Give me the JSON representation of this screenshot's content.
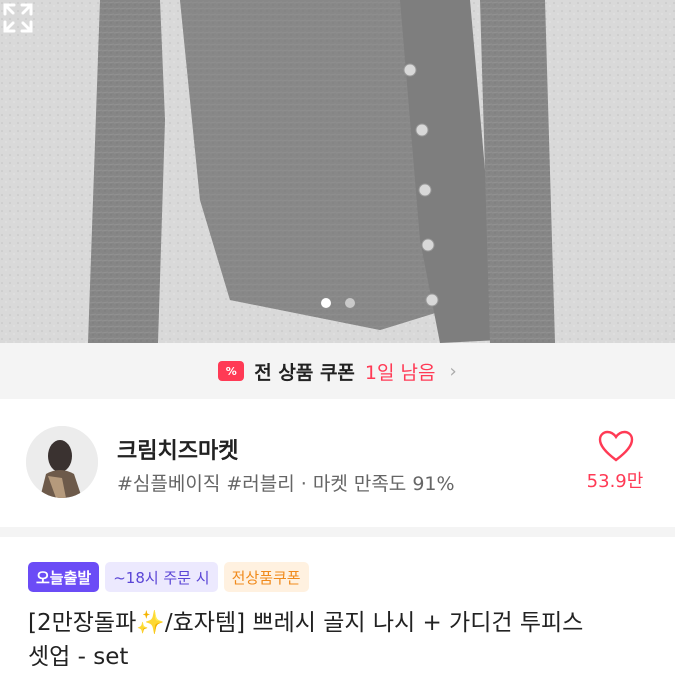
{
  "product_image": {
    "alt": "gray knit cardigan set",
    "carousel_total": 2,
    "carousel_active": 1,
    "expand_icon": "expand-icon"
  },
  "coupon": {
    "icon_label": "%",
    "text": "전 상품 쿠폰",
    "remaining": "1일 남음",
    "chevron": "›"
  },
  "shop": {
    "name": "크림치즈마켓",
    "tags": "#심플베이직 #러블리 · 마켓 만족도 91%",
    "likes": "53.9만",
    "heart_icon": "heart-icon"
  },
  "badges": [
    {
      "label": "오늘출발"
    },
    {
      "label": "~18시 주문 시"
    },
    {
      "label": "전상품쿠폰"
    }
  ],
  "product": {
    "title_prefix": "[2만장돌파",
    "sparkle": "✨",
    "title_rest": "/효자템] 쁘레시 골지 나시 + 가디건 투피스",
    "title_line2": "셋업 - set"
  },
  "colors": {
    "accent": "#ff3a55",
    "badge_purple": "#6b4cf6",
    "badge_orange": "#f08a1c"
  }
}
